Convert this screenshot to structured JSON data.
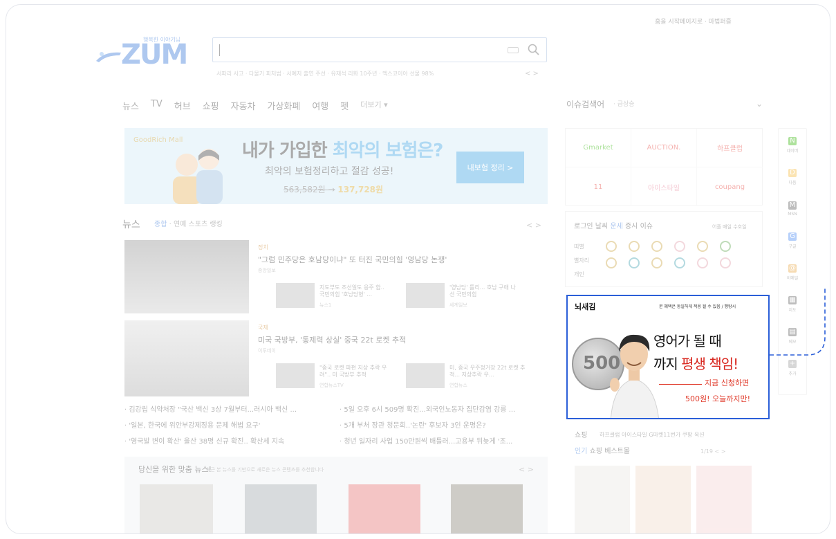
{
  "colors": {
    "brand": "#2b6fd6",
    "ad_border": "#2b5fd8",
    "ad_accent": "#e03a2a"
  },
  "header": {
    "top_links": "홈을 시작페이지로 · 마법퍼즐",
    "logo_tagline": "행복한 이야기님",
    "logo_word": "ZUM",
    "search_placeholder": "",
    "suggestions": "서파리 사고 · 다물기 피처범 · 서예지 출연 주선 · 유재석 리화 10주년 · 멕스코이아 선물 98%",
    "suggest_nav": "<  >"
  },
  "nav": {
    "items": [
      "뉴스",
      "TV",
      "허브",
      "쇼핑",
      "자동차",
      "가상화폐",
      "여행",
      "펫"
    ],
    "more": "더보기 ▾",
    "issue_label": "이슈검색어",
    "issue_value": "· 급상승",
    "issue_chev": "⌄"
  },
  "banner": {
    "brand": "GoodRich Mall",
    "headline_a": "내가 가입한 ",
    "headline_b": "최악의 보험은?",
    "sub": "최악의 보험정리하고 절감 성공!",
    "price_old": "563,582원 →",
    "price_new": "137,728원",
    "button": "내보험 정리 >"
  },
  "news": {
    "title": "뉴스",
    "tabs": [
      "종합",
      "연예",
      "스포츠",
      "랭킹"
    ],
    "nav": "<  >",
    "main1": {
      "cat": "정치",
      "headline": "\"그럼 민주당은 호남당이냐\" 또 터진 국민의힘 '영남당 논쟁'",
      "press": "중앙일보"
    },
    "sub1a": {
      "text": "지도부도 조선일도 응주 합.. 국민의힘 '호남당형' ...",
      "press": "뉴스1"
    },
    "sub1b": {
      "text": "'영남당' 틀리... 호남 구애 나선 국민의힘",
      "press": "세계일보"
    },
    "main2": {
      "cat": "국제",
      "headline": "미국 국방부, '통제력 상실' 중국 22t 로켓 추적",
      "press": "이투데이"
    },
    "sub2a": {
      "text": "\"중국 로켓 파편 지상 추락 우려\".. 미 국방부 추적",
      "press": "연합뉴스TV"
    },
    "sub2b": {
      "text": "미, 중국 우주정거장 22t 로켓 추적... 지상추락 우...",
      "press": "연합뉴스"
    },
    "list": [
      "· 김강립 식약처장 \"국산 백신 3상 7월부터...러시아 백신 ...",
      "· 5일 오후 6시 509명 확진...외국인노동자 집단감염 강릉 ...",
      "· '일본, 한국에 위안부강제징용 문제 해법 요구'",
      "· 5개 부처 장관 청문회..'논란' 후보자 3인 운명은?",
      "· '영국발 변이 확산' 울산 38명 신규 확진.. 확산세 지속",
      "· 청년 일자리 사업 150만원씩 배틀러...고용부 뒤늦게 '조..."
    ]
  },
  "recommend": {
    "title": "당신을 위한 맞춤 뉴스!",
    "desc": "최근 본 뉴스를 기반으로 새로운 뉴스 콘텐츠를 추천합니다",
    "nav": "<  >"
  },
  "shops": [
    "Gmarket",
    "AUCTION.",
    "하프클럽",
    "11",
    "아이스타일",
    "coupang"
  ],
  "fortune": {
    "tabs": [
      "로그인",
      "날씨",
      "운세",
      "증시",
      "이슈"
    ],
    "date": "어플 매일 수호일",
    "rows": [
      "띠별",
      "별자리",
      "개인"
    ]
  },
  "ad": {
    "brand": "뇌새김",
    "disclaimer": "본 혜택은 동일하게 적용 될 수 있음 / 행탕시",
    "coin_text": "500",
    "line1": "영어가 될 때",
    "line2a": "까지 ",
    "line2b": "평생 책임!",
    "cta1": "지금 신청하면",
    "cta2": "500원! 오늘까지만!"
  },
  "shop2": {
    "title": "쇼핑",
    "deal": "하프클럽 아이스타일 G마켓11번가 쿠팡 옥션",
    "tabs": [
      "인기",
      "쇼핑",
      "베스트몰"
    ],
    "page": "1/19  <  >"
  },
  "rail": [
    {
      "icon": "naver-icon",
      "label": "네이버",
      "glyph": "N",
      "color": "#2db400"
    },
    {
      "icon": "daum-icon",
      "label": "다음",
      "glyph": "D",
      "color": "#f6b93b"
    },
    {
      "icon": "msn-icon",
      "label": "MSN",
      "glyph": "M",
      "color": "#555"
    },
    {
      "icon": "google-icon",
      "label": "구글",
      "glyph": "G",
      "color": "#4285f4"
    },
    {
      "icon": "email-icon",
      "label": "이메일",
      "glyph": "@",
      "color": "#e8a33a"
    },
    {
      "icon": "map-icon",
      "label": "지도",
      "glyph": "▦",
      "color": "#555"
    },
    {
      "icon": "memo-icon",
      "label": "메모",
      "glyph": "▤",
      "color": "#555"
    },
    {
      "icon": "plus-icon",
      "label": "추가",
      "glyph": "+",
      "color": "#999"
    }
  ]
}
